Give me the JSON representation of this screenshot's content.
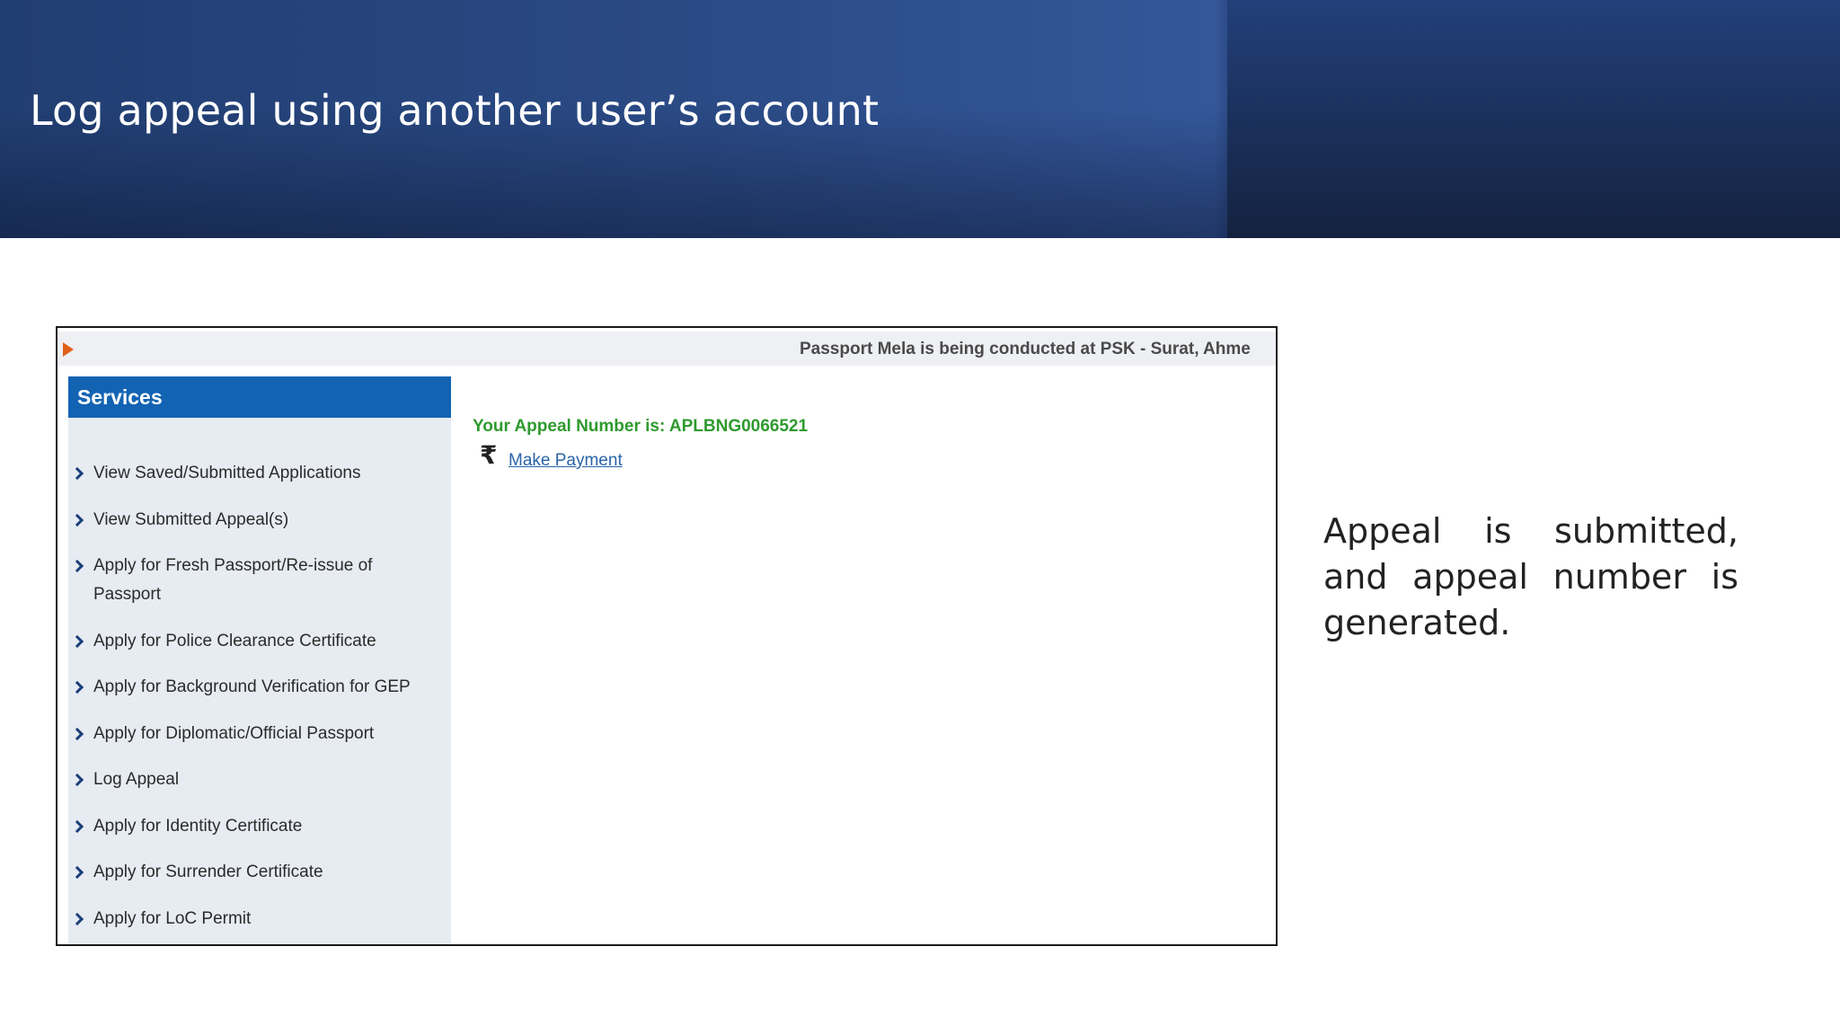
{
  "slide": {
    "title": "Log appeal using another user’s account",
    "caption": "Appeal is submitted, and appeal number is generated."
  },
  "ticker": {
    "text": "Passport Mela is being conducted at PSK - Surat, Ahme"
  },
  "sidebar": {
    "header": "Services",
    "items": [
      {
        "label": "View Saved/Submitted Applications"
      },
      {
        "label": "View Submitted Appeal(s)"
      },
      {
        "label": "Apply for Fresh Passport/Re-issue of Passport"
      },
      {
        "label": "Apply for Police Clearance Certificate"
      },
      {
        "label": "Apply for Background Verification for GEP"
      },
      {
        "label": "Apply for Diplomatic/Official Passport"
      },
      {
        "label": "Log Appeal"
      },
      {
        "label": "Apply for Identity Certificate"
      },
      {
        "label": "Apply for Surrender Certificate"
      },
      {
        "label": "Apply for LoC Permit"
      }
    ]
  },
  "main": {
    "appeal_message": "Your Appeal Number is: APLBNG0066521",
    "payment_icon": "rupee-icon",
    "payment_glyph": "₹",
    "payment_link": "Make Payment"
  },
  "colors": {
    "banner": "#2b4b86",
    "sidebar_header": "#1363b3",
    "sidebar_bg": "#e7ebf2",
    "success_text": "#2e9a2e",
    "link": "#2a64a8",
    "ticker_arrow": "#e0601a"
  }
}
